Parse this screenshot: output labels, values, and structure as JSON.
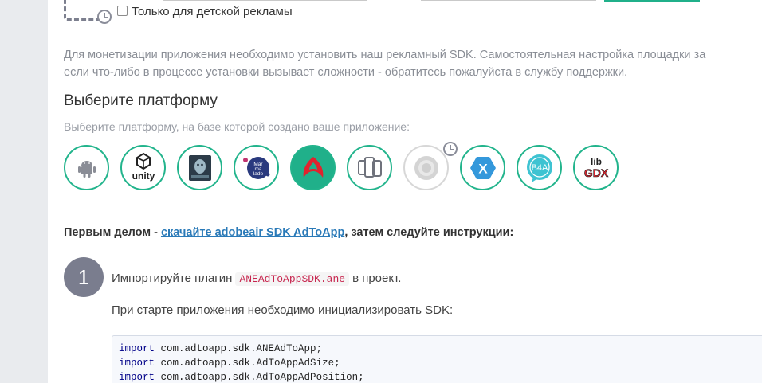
{
  "kids_filter": {
    "label": "Только для детской рекламы",
    "checked": false
  },
  "intro": {
    "line1": "Для монетизации приложения необходимо установить наш рекламный SDK. Самостоятельная настройка площадки за",
    "line2": "если что-либо в процессе установки вызывает сложности - обратитесь пожалуйста в службу поддержки."
  },
  "platform_section": {
    "title": "Выберите платформу",
    "subtitle": "Выберите платформу, на базе которой создано ваше приложение:",
    "items": [
      {
        "name": "android",
        "active": false
      },
      {
        "name": "unity",
        "label": "unity",
        "active": false
      },
      {
        "name": "cocos2d",
        "active": false
      },
      {
        "name": "marmalade",
        "label": "Marmalade",
        "active": false
      },
      {
        "name": "adobe-air",
        "active": true
      },
      {
        "name": "multiple-devices",
        "active": false
      },
      {
        "name": "corona",
        "active": false,
        "disabled": true
      },
      {
        "name": "xamarin",
        "label": "X",
        "active": false
      },
      {
        "name": "b4a",
        "label": "B4A",
        "active": false
      },
      {
        "name": "libgdx",
        "label_top": "lib",
        "label_bottom": "GDX",
        "active": false
      }
    ]
  },
  "first_step": {
    "prefix": "Первым делом - ",
    "link": "скачайте adobeair SDK AdToApp",
    "suffix": ", затем следуйте инструкции:"
  },
  "step1": {
    "number": "1",
    "text_before": "Импортируйте плагин",
    "plugin_file": "ANEAdToAppSDK.ane",
    "text_after": "в проект.",
    "init_text": "При старте приложения необходимо инициализировать SDK:"
  },
  "code": {
    "keyword": "import",
    "lines": [
      "com.adtoapp.sdk.ANEAdToApp;",
      "com.adtoapp.sdk.AdToAppAdSize;",
      "com.adtoapp.sdk.AdToAppAdPosition;"
    ]
  },
  "colors": {
    "accent": "#20b08a",
    "step_badge": "#7a7d8e",
    "link": "#2a7ab8"
  }
}
